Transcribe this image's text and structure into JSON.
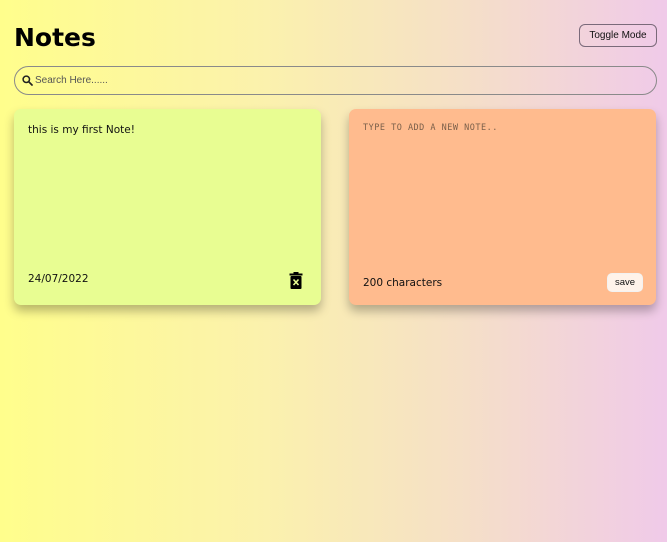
{
  "header": {
    "title": "Notes",
    "toggle_label": "Toggle Mode"
  },
  "search": {
    "placeholder": "Search Here......",
    "value": "",
    "icon": "search-icon"
  },
  "notes": [
    {
      "text": "this is my first Note!",
      "date": "24/07/2022",
      "delete_icon": "trash-icon",
      "color": "#e8fd92"
    }
  ],
  "new_note": {
    "placeholder": "TYPE TO ADD A NEW NOTE..",
    "value": "",
    "remaining": "200 characters",
    "save_label": "save",
    "color": "#ffbb8e"
  },
  "colors": {
    "background_left": "#fffe8c",
    "background_right": "#f0cae9"
  }
}
